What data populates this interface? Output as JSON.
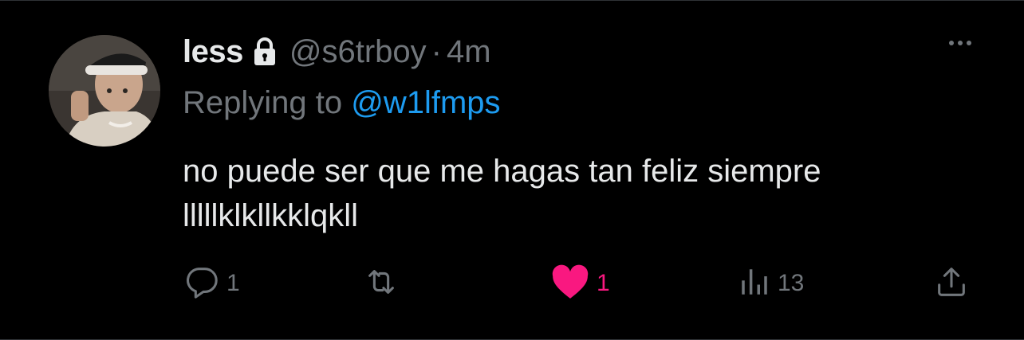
{
  "tweet": {
    "display_name": "less",
    "handle": "@s6trboy",
    "separator": "·",
    "time": "4m",
    "replying_prefix": "Replying to ",
    "replying_mention": "@w1lfmps",
    "body_lines": [
      "no puede ser que me hagas tan feliz siempre",
      "lllllklkllkklqkll"
    ]
  },
  "actions": {
    "reply_count": "1",
    "retweet_count": "",
    "like_count": "1",
    "views_count": "13"
  },
  "icons": {
    "lock": "lock-icon",
    "more": "more-icon",
    "reply": "reply-icon",
    "retweet": "retweet-icon",
    "like": "heart-icon",
    "views": "views-icon",
    "share": "share-icon"
  },
  "colors": {
    "background": "#000000",
    "text_primary": "#e7e9ea",
    "text_secondary": "#71767b",
    "link": "#1d9bf0",
    "like_active": "#f91880"
  }
}
